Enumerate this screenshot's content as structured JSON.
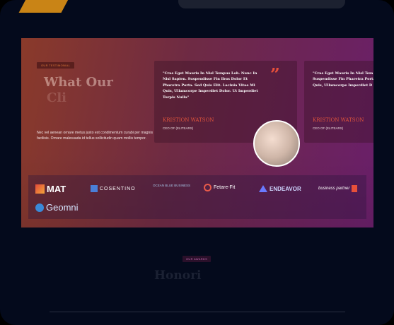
{
  "hero": {
    "pill_label": "OUR TESTIMONIAL",
    "title_line1": "What Our",
    "title_line2": "Cli",
    "description": "Nec vel aenean ornare metus justo est condimentum curabi per magnis facilisis. Ornare malesuada id tellus sollicitudin quam mollis tempor."
  },
  "testimonials": [
    {
      "quote": "\"Cras Eget Mauris In Nisl Tempus Lob. Nunc In Nisl Sapien. Suspendisse Fin Ibus Dolor Et Pharetra Porta. Sed Quis Elit. Lacinia Vitae Mi Quis, Ullamcorpe Imperdiet Dolor. Ut Imperdiet Turpis Nulla\"",
      "name": "KRISTION WATSON",
      "role": "CEO OF (ELITEARS)"
    },
    {
      "quote": "\"Cras Eget Mauris In Nisl Tem Nisl Sapien. Suspendisse Fin Pharetra Porta. Sed Quis Elit Quis, Ullamcorpe Imperdiet D Turpis Nulla\"",
      "name": "KRISTION WATSON",
      "role": "CEO OF (ELITEARS)"
    }
  ],
  "logos": {
    "mat": "MAT",
    "cosentino": "COSENTINO",
    "oceanblue": "OCEAN BLUE BUSINESS",
    "futurefit": "Fetare-Fit",
    "endeavor": "ENDEAVOR",
    "businesspartner": "business partner",
    "geomni": "Geomni"
  },
  "honors": {
    "pill_label": "OUR AWARDS",
    "title": "Honori"
  },
  "colors": {
    "accent": "#e2553c",
    "background": "#040a1c"
  }
}
